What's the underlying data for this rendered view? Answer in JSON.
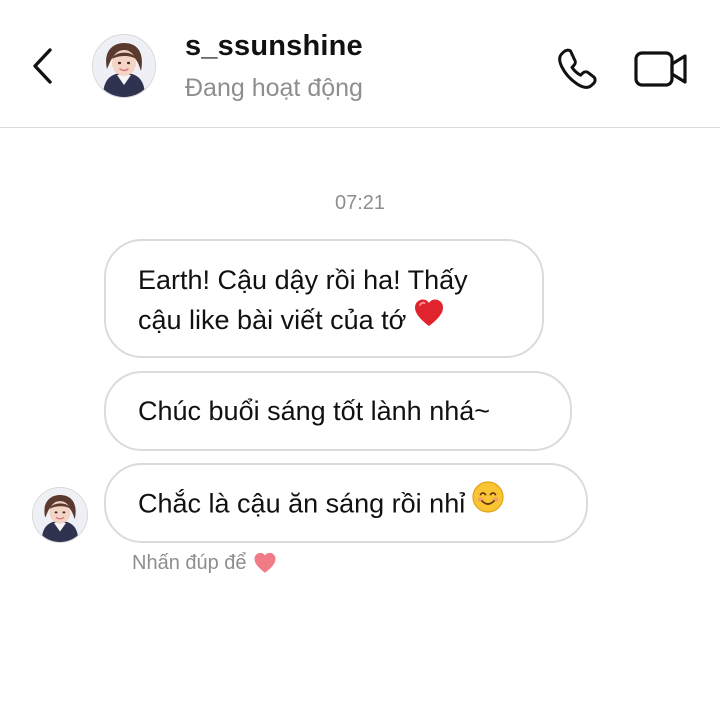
{
  "header": {
    "contact_name": "s_ssunshine",
    "status": "Đang hoạt động"
  },
  "thread": {
    "timestamp": "07:21",
    "messages": [
      {
        "lines": [
          "Earth! Cậu dậy rồi ha! Thấy",
          "cậu like bài viết của tớ"
        ],
        "trailing_icon": "red-heart-emoji"
      },
      {
        "lines": [
          "Chúc buổi sáng tốt lành nhá~"
        ]
      },
      {
        "lines": [
          "Chắc là cậu ăn sáng rồi nhỉ"
        ],
        "trailing_icon": "smiling-face-emoji"
      }
    ],
    "double_tap_hint": "Nhấn đúp để",
    "hint_icon": "pink-heart-emoji"
  },
  "colors": {
    "border": "#dbdbdb",
    "secondary_text": "#8e8e8e",
    "heart_red": "#e0242e",
    "hint_heart": "#f07a85"
  }
}
